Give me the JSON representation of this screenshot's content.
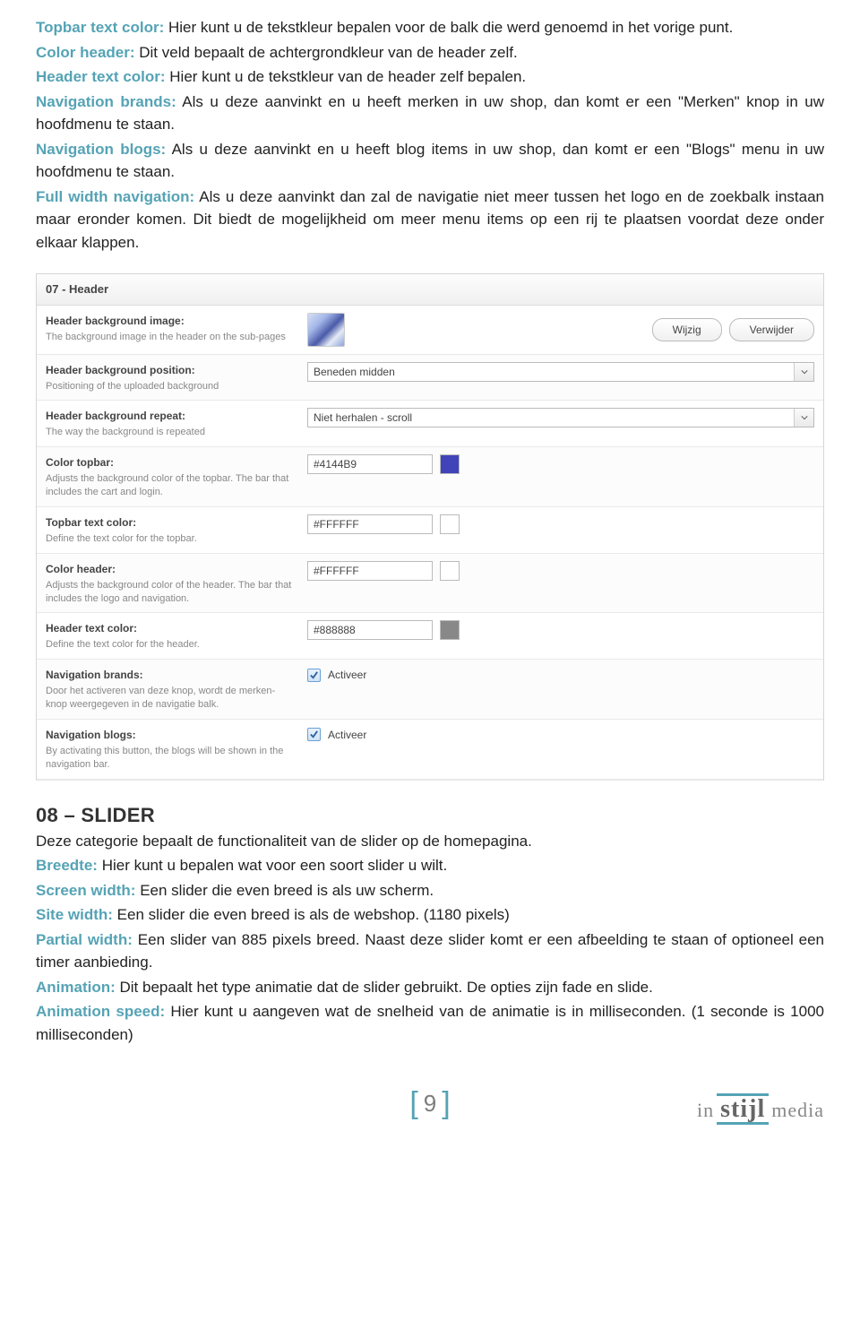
{
  "intro": {
    "p1_term": "Topbar text color:",
    "p1_text": " Hier kunt u de tekstkleur bepalen voor de balk die werd genoemd in het vorige punt.",
    "p2_term": "Color header:",
    "p2_text": " Dit veld bepaalt de achtergrondkleur van de header zelf.",
    "p3_term": "Header text color:",
    "p3_text": " Hier kunt u de tekstkleur van de header zelf bepalen.",
    "p4_term": "Navigation brands:",
    "p4_text": " Als u deze aanvinkt en u heeft merken in uw shop, dan komt er een \"Merken\" knop in uw hoofdmenu te staan.",
    "p5_term": "Navigation blogs:",
    "p5_text": " Als u deze aanvinkt en u heeft blog items in uw shop, dan komt er een \"Blogs\" menu in uw hoofdmenu te staan.",
    "p6_term": "Full width navigation:",
    "p6_text": " Als u deze aanvinkt dan zal de navigatie niet meer tussen het logo en de zoekbalk instaan maar eronder komen. Dit biedt de mogelijkheid om meer menu items op een rij te plaatsen voordat deze onder elkaar klappen."
  },
  "panel": {
    "title": "07 - Header",
    "r1": {
      "label": "Header background image:",
      "desc": "The background image in the header on the sub-pages",
      "btn1": "Wijzig",
      "btn2": "Verwijder"
    },
    "r2": {
      "label": "Header background position:",
      "desc": "Positioning of the uploaded background",
      "value": "Beneden midden"
    },
    "r3": {
      "label": "Header background repeat:",
      "desc": "The way the background is repeated",
      "value": "Niet herhalen - scroll"
    },
    "r4": {
      "label": "Color topbar:",
      "desc": "Adjusts the background color of the topbar. The bar that includes the cart and login.",
      "value": "#4144B9",
      "swatch": "#4144B9"
    },
    "r5": {
      "label": "Topbar text color:",
      "desc": "Define the text color for the topbar.",
      "value": "#FFFFFF",
      "swatch": "#FFFFFF"
    },
    "r6": {
      "label": "Color header:",
      "desc": "Adjusts the background color of the header. The bar that includes the logo and navigation.",
      "value": "#FFFFFF",
      "swatch": "#FFFFFF"
    },
    "r7": {
      "label": "Header text color:",
      "desc": "Define the text color for the header.",
      "value": "#888888",
      "swatch": "#888888"
    },
    "r8": {
      "label": "Navigation brands:",
      "desc": "Door het activeren van deze knop, wordt de merken-knop weergegeven in de navigatie balk.",
      "cb_label": "Activeer"
    },
    "r9": {
      "label": "Navigation blogs:",
      "desc": "By activating this button, the blogs will be shown in the navigation bar.",
      "cb_label": "Activeer"
    }
  },
  "section08": {
    "heading": "08 – SLIDER",
    "p0": "Deze categorie bepaalt de functionaliteit van de slider op de homepagina.",
    "p1_term": "Breedte:",
    "p1_text": " Hier kunt u bepalen wat voor een soort slider u wilt.",
    "p2_term": "Screen width:",
    "p2_text": " Een slider die even breed is als uw scherm.",
    "p3_term": "Site width:",
    "p3_text": " Een slider die even breed is als de webshop. (1180 pixels)",
    "p4_term": "Partial width:",
    "p4_text": " Een slider van 885 pixels breed. Naast deze slider komt er een afbeelding te staan of optioneel een timer aanbieding.",
    "p5_term": "Animation:",
    "p5_text": " Dit bepaalt het type animatie dat de slider gebruikt. De opties zijn fade en slide.",
    "p6_term": "Animation speed:",
    "p6_text": " Hier kunt u aangeven wat de snelheid van de animatie is in milliseconden. (1 seconde is 1000 milliseconden)"
  },
  "footer": {
    "page": "9",
    "logo_in": "in",
    "logo_mid": "stijl",
    "logo_media": "media"
  }
}
